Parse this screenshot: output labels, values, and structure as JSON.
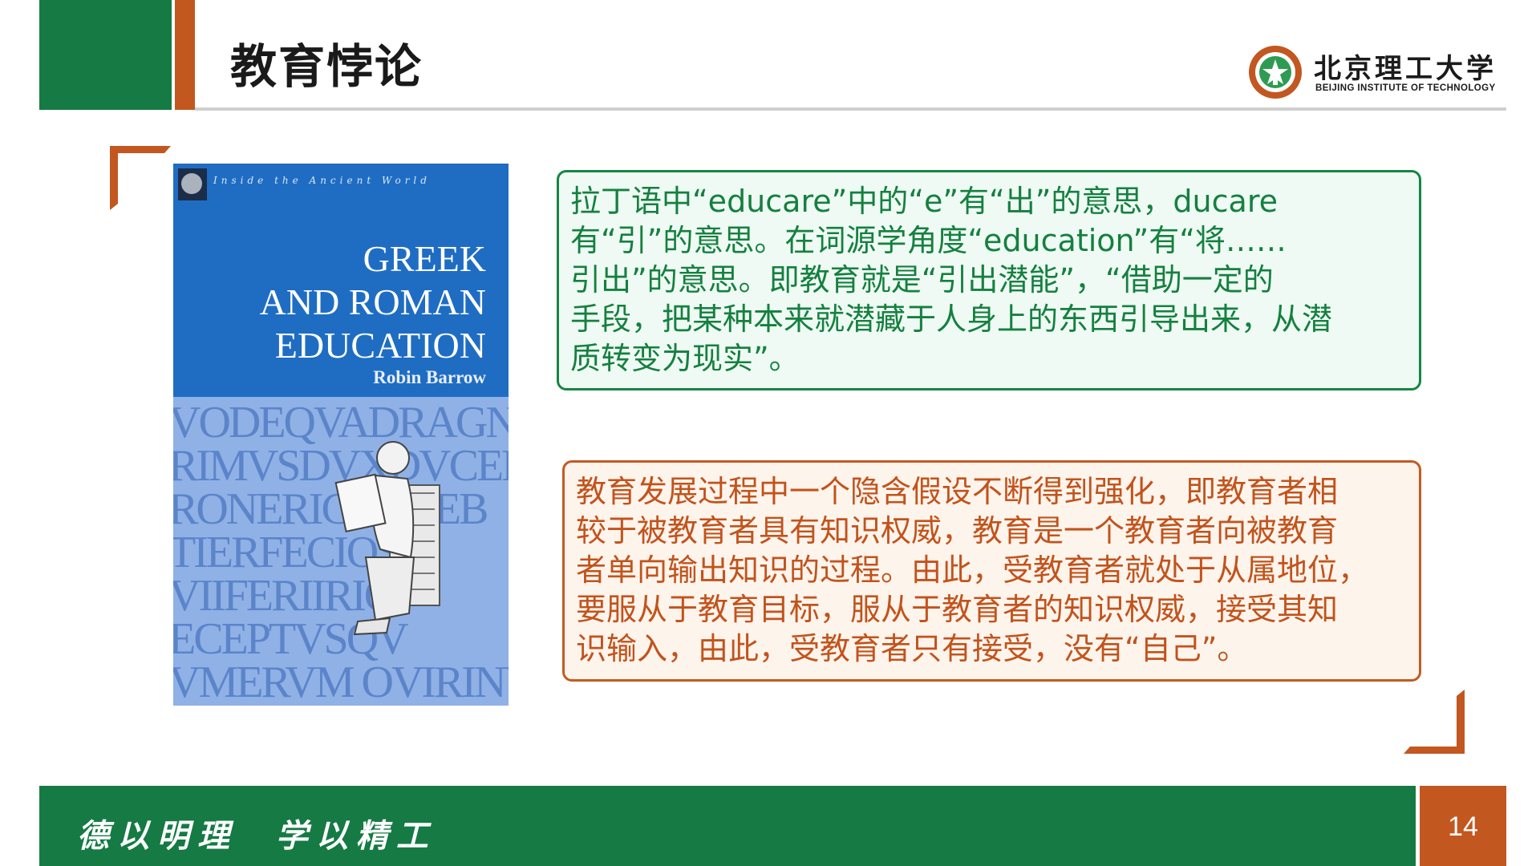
{
  "header": {
    "title": "教育悖论",
    "logo_cn": "北京理工大学",
    "logo_en": "BEIJING INSTITUTE OF TECHNOLOGY"
  },
  "book": {
    "series": "Inside the Ancient World",
    "title_lines": [
      "GREEK",
      "AND ROMAN",
      "EDUCATION"
    ],
    "author": "Robin Barrow",
    "inscription_lines": [
      "VODEQVADRAGNIAISQ",
      "RIMVSDVXDVCEM",
      "RONERIGECAEB",
      "TIERFECIOSP",
      "VIIFERIIRIO",
      "ECEPTVSQV",
      "VMERVM OVIRINVS"
    ]
  },
  "box1": {
    "lines": [
      "拉丁语中“educare”中的“e”有“出”的意思，ducare",
      "有“引”的意思。在词源学角度“education”有“将……",
      "引出”的意思。即教育就是“引出潜能”，“借助一定的",
      "手段，把某种本来就潜藏于人身上的东西引导出来，从潜",
      "质转变为现实”。"
    ]
  },
  "box2": {
    "lines": [
      "教育发展过程中一个隐含假设不断得到强化，即教育者相",
      "较于被教育者具有知识权威，教育是一个教育者向被教育",
      "者单向输出知识的过程。由此，受教育者就处于从属地位，",
      "要服从于教育目标，服从于教育者的知识权威，接受其知",
      "识输入，由此，受教育者只有接受，没有“自己”。"
    ]
  },
  "footer": {
    "motto": "德以明理  学以精工",
    "page_number": "14"
  },
  "colors": {
    "green": "#157a43",
    "orange": "#c2571f",
    "book_blue": "#1f6dc3"
  }
}
